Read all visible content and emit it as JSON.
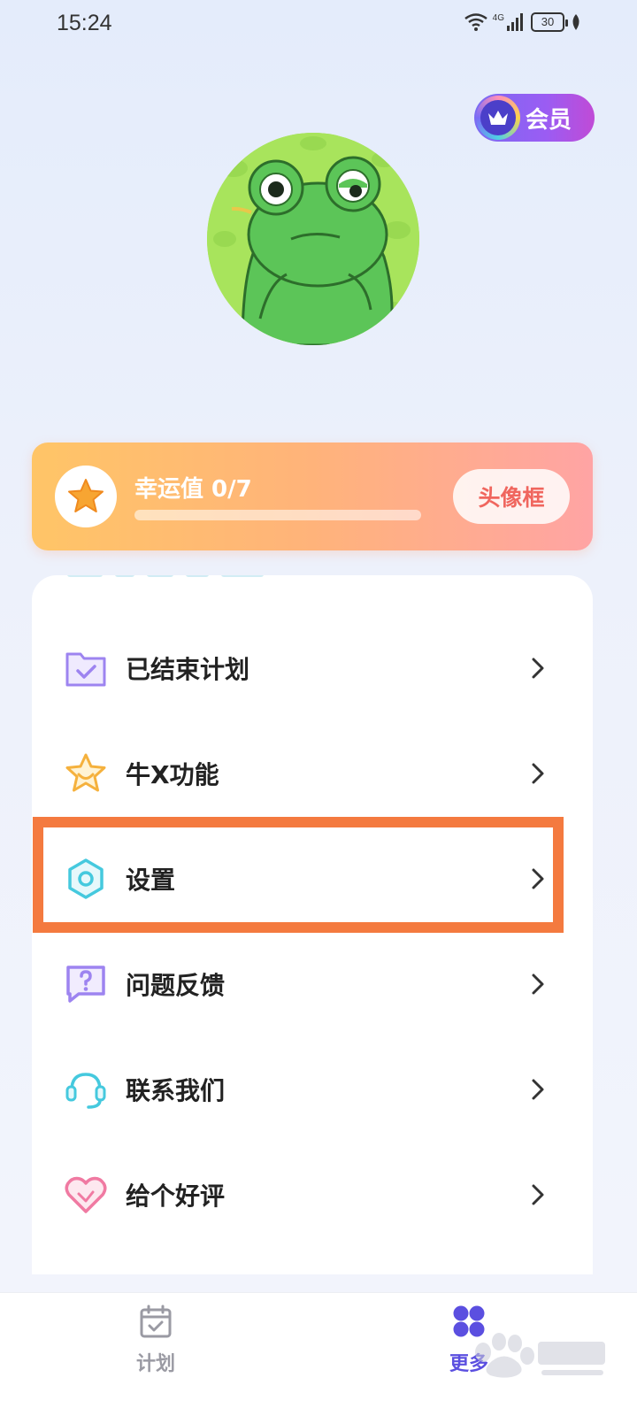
{
  "status": {
    "time": "15:24",
    "net": "4G",
    "battery": "30"
  },
  "header": {
    "vip_label": "会员"
  },
  "luck": {
    "title": "幸运值 0/7",
    "progress": 0,
    "frame_button": "头像框"
  },
  "menu": {
    "items": [
      {
        "label": "已结束计划",
        "icon": "folder-check-icon"
      },
      {
        "label": "牛X功能",
        "icon": "star-smile-icon"
      },
      {
        "label": "设置",
        "icon": "settings-hexagon-icon"
      },
      {
        "label": "问题反馈",
        "icon": "feedback-question-icon"
      },
      {
        "label": "联系我们",
        "icon": "headset-icon"
      },
      {
        "label": "给个好评",
        "icon": "heart-icon"
      }
    ]
  },
  "nav": {
    "tabs": [
      {
        "label": "计划",
        "active": false
      },
      {
        "label": "更多",
        "active": true
      }
    ]
  },
  "colors": {
    "accent": "#5b4fe0",
    "highlight": "#f47a3f",
    "luck_gradient_start": "#ffc567",
    "luck_gradient_end": "#ffa4a4"
  }
}
